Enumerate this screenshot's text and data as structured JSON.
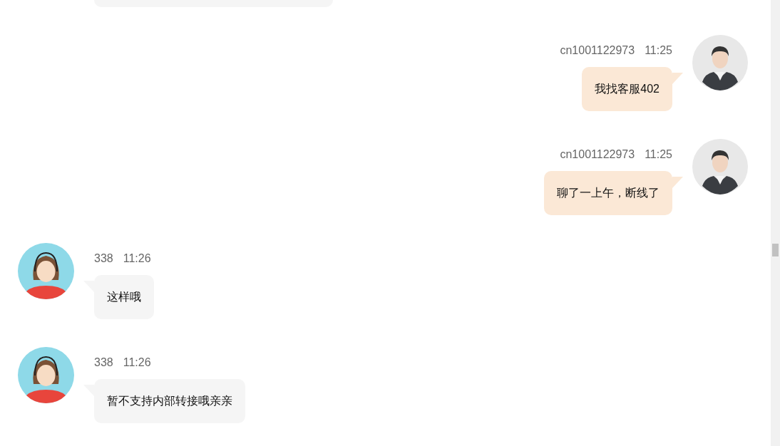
{
  "messages": [
    {
      "kind": "sent",
      "sender": "cn1001122973",
      "time": "11:25",
      "text": "我找客服402"
    },
    {
      "kind": "sent",
      "sender": "cn1001122973",
      "time": "11:25",
      "text": "聊了一上午，断线了"
    },
    {
      "kind": "received",
      "sender": "338",
      "time": "11:26",
      "text": "这样哦"
    },
    {
      "kind": "received",
      "sender": "338",
      "time": "11:26",
      "text": "暂不支持内部转接哦亲亲"
    }
  ]
}
